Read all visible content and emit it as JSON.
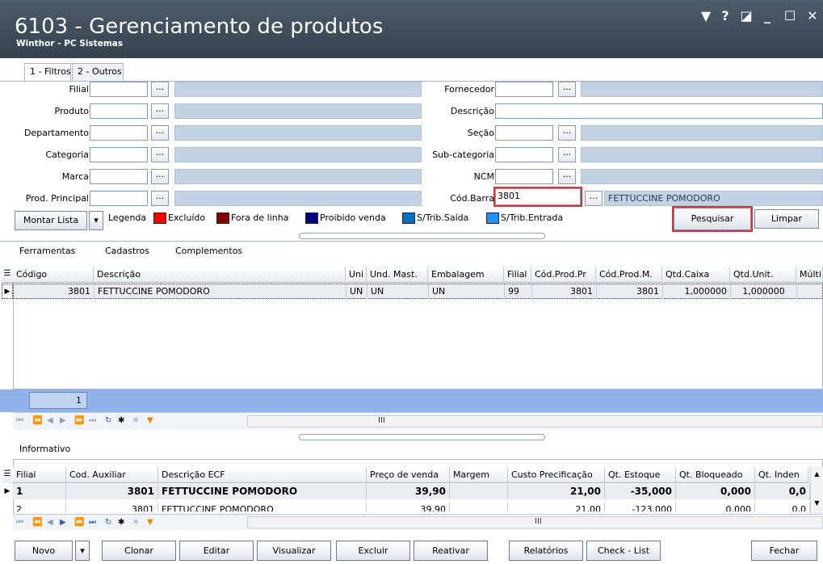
{
  "window": {
    "title": "6103 - Gerenciamento de produtos",
    "subtitle": "Winthor - PC Sistemas",
    "controls": [
      "▼",
      "?",
      "◪",
      "_",
      "☐",
      "✕"
    ]
  },
  "tabs": [
    {
      "label": "1 - Filtros"
    },
    {
      "label": "2 - Outros"
    }
  ],
  "filters": {
    "left": [
      {
        "label": "Filial",
        "value": ""
      },
      {
        "label": "Produto",
        "value": ""
      },
      {
        "label": "Departamento",
        "value": ""
      },
      {
        "label": "Categoria",
        "value": ""
      },
      {
        "label": "Marca",
        "value": ""
      },
      {
        "label": "Prod. Principal",
        "value": ""
      }
    ],
    "right": {
      "fornecedor": "Fornecedor",
      "descricao": "Descrição",
      "secao": "Seção",
      "subcategoria": "Sub-categoria",
      "ncm": "NCM",
      "cod_barra": "Cód.Barra",
      "cod_barra_value": "3801",
      "cod_barra_desc": "FETTUCCINE POMODORO"
    },
    "ellipsis": "..."
  },
  "legend": {
    "montar_lista": "Montar Lista",
    "title": "Legenda",
    "items": [
      {
        "label": "Excluído",
        "color": "#ff0000"
      },
      {
        "label": "Fora de linha",
        "color": "#800000"
      },
      {
        "label": "Proibido venda",
        "color": "#000080"
      },
      {
        "label": "S/Trib.Saída",
        "color": "#0072c6"
      },
      {
        "label": "S/Trib.Entrada",
        "color": "#1e90ff"
      }
    ]
  },
  "actions": {
    "pesquisar": "Pesquisar",
    "limpar": "Limpar"
  },
  "menu": {
    "ferramentas": "Ferramentas",
    "cadastros": "Cadastros",
    "complementos": "Complementos"
  },
  "product_grid": {
    "columns": [
      "Código",
      "Descrição",
      "Uni",
      "Und. Mast.",
      "Embalagem",
      "Filial",
      "Cód.Prod.Pr",
      "Cód.Prod.M.",
      "Qtd.Caixa",
      "Qtd.Unit.",
      "Múlti"
    ],
    "rows": [
      [
        "3801",
        "FETTUCCINE POMODORO",
        "UN",
        "UN",
        "UN",
        "99",
        "3801",
        "3801",
        "1,000000",
        "1,000000",
        ""
      ]
    ],
    "footer_count": "1",
    "scroll_mid": "III"
  },
  "info": {
    "title": "Informativo",
    "columns": [
      "Filial",
      "Cod. Auxiliar",
      "Descrição ECF",
      "Preço de venda",
      "Margem",
      "Custo Precificação",
      "Qt. Estoque",
      "Qt. Bloqueado",
      "Qt. Inden"
    ],
    "rows": [
      [
        "1",
        "3801",
        "FETTUCCINE POMODORO",
        "39,90",
        "",
        "21,00",
        "-35,000",
        "0,000",
        "0,0"
      ],
      [
        "2",
        "3801",
        "FETTUCCINE POMODORO",
        "39,90",
        "",
        "21,00",
        "-123,000",
        "0,000",
        "0,0"
      ]
    ],
    "scroll_mid": "III"
  },
  "bottom_buttons": {
    "novo": "Novo",
    "clonar": "Clonar",
    "editar": "Editar",
    "visualizar": "Visualizar",
    "excluir": "Excluir",
    "reativar": "Reativar",
    "relatorios": "Relatórios",
    "checklist": "Check - List",
    "fechar": "Fechar"
  }
}
